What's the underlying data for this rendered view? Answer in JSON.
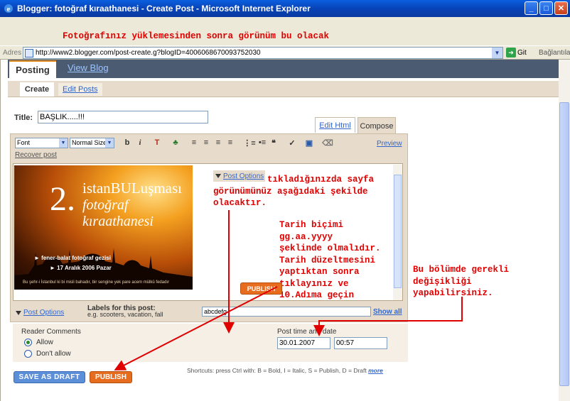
{
  "window": {
    "title": "Blogger: fotoğraf kıraathanesi - Create Post - Microsoft Internet Explorer",
    "buttons": {
      "minimize": "_",
      "maximize": "□",
      "close": "✕"
    }
  },
  "annotations": {
    "top_note": "Fotoğrafınız yüklemesinden sonra görünüm bu olacak",
    "post_options_note": [
      "tıkladığınızda sayfa",
      "görünümünüz aşağıdaki şekilde",
      "olacaktır."
    ],
    "date_note": [
      "Tarih biçimi",
      "gg.aa.yyyy",
      "şeklinde olmalıdır.",
      "Tarih düzeltmesini",
      "yaptıktan sonra",
      "tıklayınız ve",
      "10.Adıma geçin"
    ],
    "section_note": [
      "Bu bölümde gerekli",
      "değişikliği",
      "yapabilirsiniz."
    ],
    "annotation_color": "#e00000"
  },
  "addressbar": {
    "label": "Adres",
    "url": "http://www2.blogger.com/post-create.g?blogID=4006068670093752030",
    "go_label": "Git",
    "links_label": "Bağlantılar",
    "dropdown_icon": "▼"
  },
  "nav": {
    "tabs": [
      {
        "label": "Posting",
        "active": true
      },
      {
        "label": "View Blog",
        "active": false
      }
    ],
    "subtabs": [
      {
        "label": "Create",
        "active": true
      },
      {
        "label": "Edit Posts",
        "active": false
      }
    ]
  },
  "post": {
    "title_label": "Title:",
    "title_value": "BAŞLIK.....!!!"
  },
  "editor": {
    "mode_tabs": [
      {
        "label": "Edit Html",
        "active": false
      },
      {
        "label": "Compose",
        "active": true
      }
    ],
    "font_select": "Font",
    "size_select": "Normal Size",
    "toolbar_icons": [
      "bold-icon",
      "italic-icon",
      "text-color-icon",
      "link-icon",
      "align-left-icon",
      "align-center-icon",
      "align-right-icon",
      "justify-icon",
      "numbered-list-icon",
      "bulleted-list-icon",
      "blockquote-icon",
      "spellcheck-icon",
      "add-image-icon",
      "remove-formatting-icon"
    ],
    "toolbar_glyphs": {
      "bold": "b",
      "italic": "i",
      "text_color": "T",
      "link": "♣",
      "align_left": "≡",
      "align_center": "≡",
      "align_right": "≡",
      "justify": "≡",
      "numbered_list": "⋮≡",
      "bulleted_list": "•≡",
      "blockquote": "❝",
      "spellcheck": "✓",
      "image": "▣",
      "eraser": "⌫"
    },
    "preview_label": "Preview",
    "recover_label": "Recover post",
    "image": {
      "number": "2.",
      "line1": "istanBULuşması",
      "line2": "fotoğraf kıraathanesi",
      "bullet1": "fener-balat fotoğraf gezisi",
      "bullet2": "17 Aralık 2006 Pazar",
      "caption": "Bu şehr-i İstanbul ki bi misli bahadır, bir sengine yek pare acem mülkü fedadır"
    },
    "post_options_label": "Post Options",
    "publish_inline_label": "PUBLISH"
  },
  "labels": {
    "post_options_label": "Post Options",
    "title": "Labels for this post:",
    "hint": "e.g. scooters, vacation, fall",
    "value": "abcdefg",
    "show_all": "Show all"
  },
  "options": {
    "reader_comments_label": "Reader Comments",
    "allow_label": "Allow",
    "dont_allow_label": "Don't allow",
    "allow_selected": true,
    "post_time_label": "Post time and date",
    "date_value": "30.01.2007",
    "time_value": "00:57"
  },
  "actions": {
    "save_draft_label": "SAVE AS DRAFT",
    "publish_label": "PUBLISH",
    "shortcuts_text": "Shortcuts: press Ctrl with: B = Bold, I = Italic, S = Publish, D = Draft",
    "more_label": "more"
  },
  "colors": {
    "tab_bar": "#4a5b72",
    "tab_accent": "#e08a1e",
    "subtab_bar": "#e7dccb",
    "publish": "#e86c1e",
    "draft": "#5c8fd8",
    "link": "#3366cc"
  }
}
